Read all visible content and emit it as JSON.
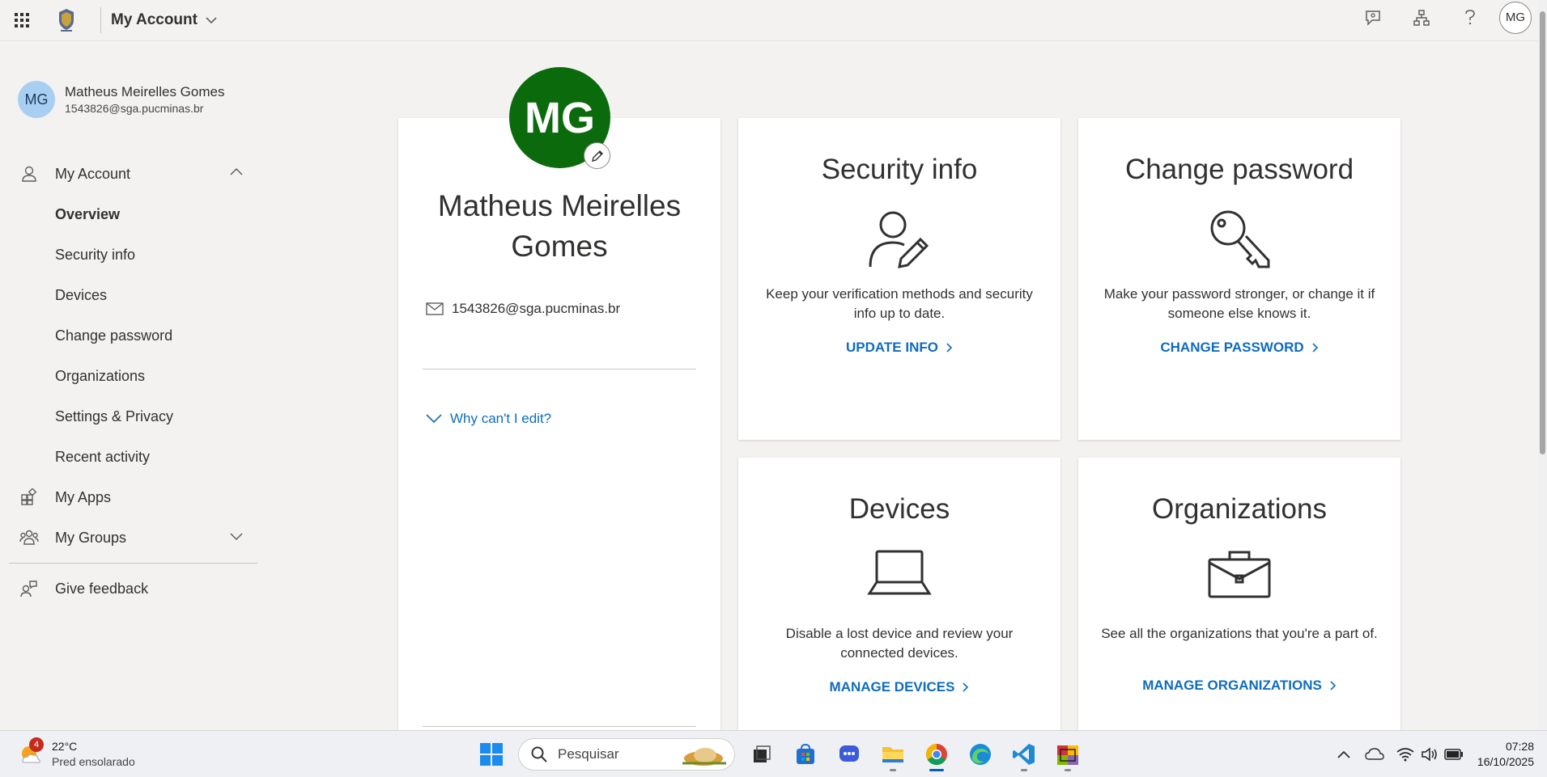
{
  "topbar": {
    "title": "My Account",
    "user_initials": "MG"
  },
  "sidebar": {
    "user": {
      "initials": "MG",
      "name": "Matheus Meirelles Gomes",
      "email": "1543826@sga.pucminas.br"
    },
    "my_account_label": "My Account",
    "sub_items": [
      "Overview",
      "Security info",
      "Devices",
      "Change password",
      "Organizations",
      "Settings & Privacy",
      "Recent activity"
    ],
    "my_apps_label": "My Apps",
    "my_groups_label": "My Groups",
    "give_feedback_label": "Give feedback"
  },
  "profile_card": {
    "initials": "MG",
    "name": "Matheus Meirelles Gomes",
    "email": "1543826@sga.pucminas.br",
    "why_cant_edit": "Why can't I edit?"
  },
  "tiles": {
    "security": {
      "title": "Security info",
      "desc": "Keep your verification methods and security info up to date.",
      "link": "UPDATE INFO"
    },
    "password": {
      "title": "Change password",
      "desc": "Make your password stronger, or change it if someone else knows it.",
      "link": "CHANGE PASSWORD"
    },
    "devices": {
      "title": "Devices",
      "desc": "Disable a lost device and review your connected devices.",
      "link": "MANAGE DEVICES"
    },
    "organizations": {
      "title": "Organizations",
      "desc": "See all the organizations that you're a part of.",
      "link": "MANAGE ORGANIZATIONS"
    }
  },
  "taskbar": {
    "weather_badge": "4",
    "temperature": "22°C",
    "weather_desc": "Pred ensolarado",
    "search_placeholder": "Pesquisar",
    "time": "07:28",
    "date": "16/10/2025"
  },
  "colors": {
    "accent": "#0f6cbd",
    "avatar_green": "#0b6a0b",
    "side_avatar": "#a8cff2",
    "background": "#f3f2f1"
  }
}
